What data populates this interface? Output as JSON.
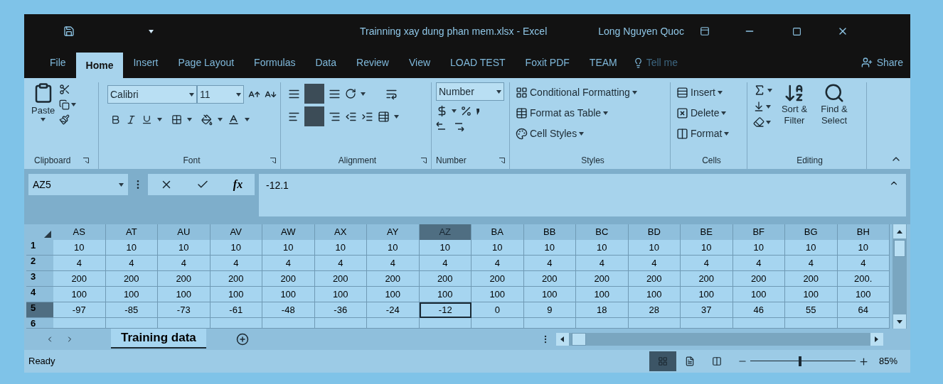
{
  "title_bar": {
    "title": "Trainning xay dung phan mem.xlsx - Excel",
    "user": "Long Nguyen Quoc"
  },
  "tabs": [
    {
      "label": "File",
      "selected": false
    },
    {
      "label": "Home",
      "selected": true
    },
    {
      "label": "Insert",
      "selected": false
    },
    {
      "label": "Page Layout",
      "selected": false
    },
    {
      "label": "Formulas",
      "selected": false
    },
    {
      "label": "Data",
      "selected": false
    },
    {
      "label": "Review",
      "selected": false
    },
    {
      "label": "View",
      "selected": false
    },
    {
      "label": "LOAD TEST",
      "selected": false
    },
    {
      "label": "Foxit PDF",
      "selected": false
    },
    {
      "label": "TEAM",
      "selected": false
    }
  ],
  "tell_me": "Tell me",
  "share": "Share",
  "ribbon": {
    "clipboard": {
      "paste": "Paste",
      "label": "Clipboard"
    },
    "font": {
      "font_name": "Calibri",
      "font_size": "11",
      "label": "Font"
    },
    "alignment": {
      "label": "Alignment"
    },
    "number": {
      "format": "Number",
      "label": "Number"
    },
    "styles": {
      "items": [
        "Conditional Formatting",
        "Format as Table",
        "Cell Styles"
      ],
      "label": "Styles"
    },
    "cells": {
      "items": [
        "Insert",
        "Delete",
        "Format"
      ],
      "label": "Cells"
    },
    "editing": {
      "sort": "Sort & Filter",
      "find": "Find & Select",
      "label": "Editing"
    }
  },
  "formula_bar": {
    "name_box": "AZ5",
    "function_label": "fx",
    "value": "-12.1"
  },
  "grid": {
    "columns": [
      {
        "label": "AS",
        "selected": false
      },
      {
        "label": "AT",
        "selected": false
      },
      {
        "label": "AU",
        "selected": false
      },
      {
        "label": "AV",
        "selected": false
      },
      {
        "label": "AW",
        "selected": false
      },
      {
        "label": "AX",
        "selected": false
      },
      {
        "label": "AY",
        "selected": false
      },
      {
        "label": "AZ",
        "selected": true
      },
      {
        "label": "BA",
        "selected": false
      },
      {
        "label": "BB",
        "selected": false
      },
      {
        "label": "BC",
        "selected": false
      },
      {
        "label": "BD",
        "selected": false
      },
      {
        "label": "BE",
        "selected": false
      },
      {
        "label": "BF",
        "selected": false
      },
      {
        "label": "BG",
        "selected": false
      },
      {
        "label": "BH",
        "selected": false
      }
    ],
    "rows": [
      {
        "number": "1",
        "selected": false,
        "cells": [
          "10",
          "10",
          "10",
          "10",
          "10",
          "10",
          "10",
          "10",
          "10",
          "10",
          "10",
          "10",
          "10",
          "10",
          "10",
          "10"
        ]
      },
      {
        "number": "2",
        "selected": false,
        "cells": [
          "4",
          "4",
          "4",
          "4",
          "4",
          "4",
          "4",
          "4",
          "4",
          "4",
          "4",
          "4",
          "4",
          "4",
          "4",
          "4"
        ]
      },
      {
        "number": "3",
        "selected": false,
        "cells": [
          "200",
          "200",
          "200",
          "200",
          "200",
          "200",
          "200",
          "200",
          "200",
          "200",
          "200",
          "200",
          "200",
          "200",
          "200",
          "200."
        ]
      },
      {
        "number": "4",
        "selected": false,
        "cells": [
          "100",
          "100",
          "100",
          "100",
          "100",
          "100",
          "100",
          "100",
          "100",
          "100",
          "100",
          "100",
          "100",
          "100",
          "100",
          "100"
        ]
      },
      {
        "number": "5",
        "selected": true,
        "cells": [
          "-97",
          "-85",
          "-73",
          "-61",
          "-48",
          "-36",
          "-24",
          "-12",
          "0",
          "9",
          "18",
          "28",
          "37",
          "46",
          "55",
          "64"
        ]
      },
      {
        "number": "6",
        "selected": false
      }
    ]
  },
  "sheet_tabs": [
    {
      "label": "Training data",
      "selected": true
    }
  ],
  "status_bar": {
    "status": "Ready",
    "views": [
      {
        "kind": "normal",
        "selected": true
      },
      {
        "kind": "page_layout",
        "selected": false
      },
      {
        "kind": "page_break",
        "selected": false
      }
    ],
    "zoom": {
      "level": 0.47,
      "reading": "85%"
    }
  }
}
